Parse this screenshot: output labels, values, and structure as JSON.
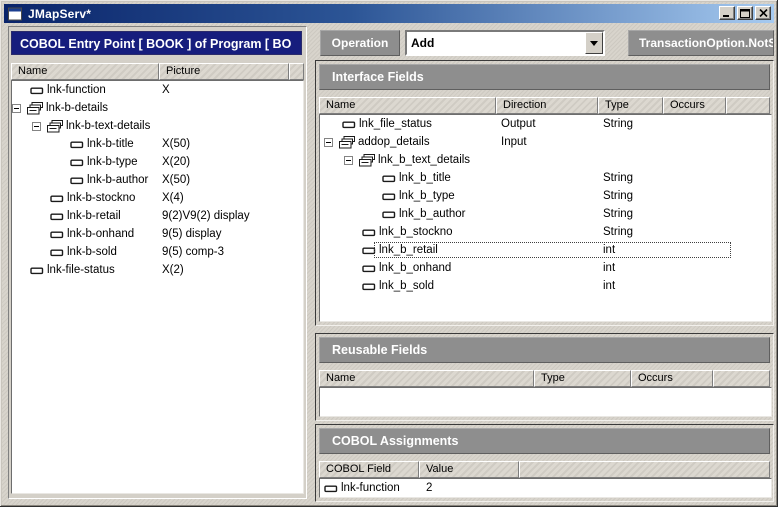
{
  "window": {
    "title": "JMapServ*"
  },
  "left_panel": {
    "header": "COBOL Entry Point [ BOOK ] of Program [ BO",
    "columns": [
      "Name",
      "Picture"
    ],
    "rows": [
      {
        "name": "lnk-function",
        "picture": "X",
        "level": 1,
        "kind": "field"
      },
      {
        "name": "lnk-b-details",
        "picture": "",
        "level": 1,
        "kind": "group",
        "expanded": true
      },
      {
        "name": "lnk-b-text-details",
        "picture": "",
        "level": 2,
        "kind": "group",
        "expanded": true
      },
      {
        "name": "lnk-b-title",
        "picture": "X(50)",
        "level": 3,
        "kind": "field"
      },
      {
        "name": "lnk-b-type",
        "picture": "X(20)",
        "level": 3,
        "kind": "field"
      },
      {
        "name": "lnk-b-author",
        "picture": "X(50)",
        "level": 3,
        "kind": "field"
      },
      {
        "name": "lnk-b-stockno",
        "picture": "X(4)",
        "level": 2,
        "kind": "field"
      },
      {
        "name": "lnk-b-retail",
        "picture": "9(2)V9(2) display",
        "level": 2,
        "kind": "field"
      },
      {
        "name": "lnk-b-onhand",
        "picture": "9(5) display",
        "level": 2,
        "kind": "field"
      },
      {
        "name": "lnk-b-sold",
        "picture": "9(5) comp-3",
        "level": 2,
        "kind": "field"
      },
      {
        "name": "lnk-file-status",
        "picture": "X(2)",
        "level": 1,
        "kind": "field"
      }
    ]
  },
  "operation": {
    "label": "Operation",
    "selected_value": "Add",
    "transaction_option": "TransactionOption.NotS"
  },
  "interface_fields": {
    "title": "Interface Fields",
    "columns": [
      "Name",
      "Direction",
      "Type",
      "Occurs"
    ],
    "rows": [
      {
        "name": "lnk_file_status",
        "direction": "Output",
        "type": "String",
        "occurs": "",
        "level": 1,
        "kind": "field"
      },
      {
        "name": "addop_details",
        "direction": "Input",
        "type": "",
        "occurs": "",
        "level": 1,
        "kind": "group",
        "expanded": true
      },
      {
        "name": "lnk_b_text_details",
        "direction": "",
        "type": "",
        "occurs": "",
        "level": 2,
        "kind": "group",
        "expanded": true
      },
      {
        "name": "lnk_b_title",
        "direction": "",
        "type": "String",
        "occurs": "",
        "level": 3,
        "kind": "field"
      },
      {
        "name": "lnk_b_type",
        "direction": "",
        "type": "String",
        "occurs": "",
        "level": 3,
        "kind": "field"
      },
      {
        "name": "lnk_b_author",
        "direction": "",
        "type": "String",
        "occurs": "",
        "level": 3,
        "kind": "field"
      },
      {
        "name": "lnk_b_stockno",
        "direction": "",
        "type": "String",
        "occurs": "",
        "level": 2,
        "kind": "field"
      },
      {
        "name": "lnk_b_retail",
        "direction": "",
        "type": "int",
        "occurs": "",
        "level": 2,
        "kind": "field",
        "selected": true
      },
      {
        "name": "lnk_b_onhand",
        "direction": "",
        "type": "int",
        "occurs": "",
        "level": 2,
        "kind": "field"
      },
      {
        "name": "lnk_b_sold",
        "direction": "",
        "type": "int",
        "occurs": "",
        "level": 2,
        "kind": "field"
      }
    ]
  },
  "reusable_fields": {
    "title": "Reusable Fields",
    "columns": [
      "Name",
      "Type",
      "Occurs"
    ],
    "rows": []
  },
  "cobol_assignments": {
    "title": "COBOL Assignments",
    "columns": [
      "COBOL Field",
      "Value"
    ],
    "rows": [
      {
        "field": "lnk-function",
        "value": "2"
      }
    ]
  },
  "colors": {
    "titlebar_left": "#0a246a",
    "titlebar_right": "#a6caf0",
    "panel_header_blue": "#161d7d",
    "section_header_gray": "#8e8e8e",
    "window_gray": "#d4d0c8"
  }
}
